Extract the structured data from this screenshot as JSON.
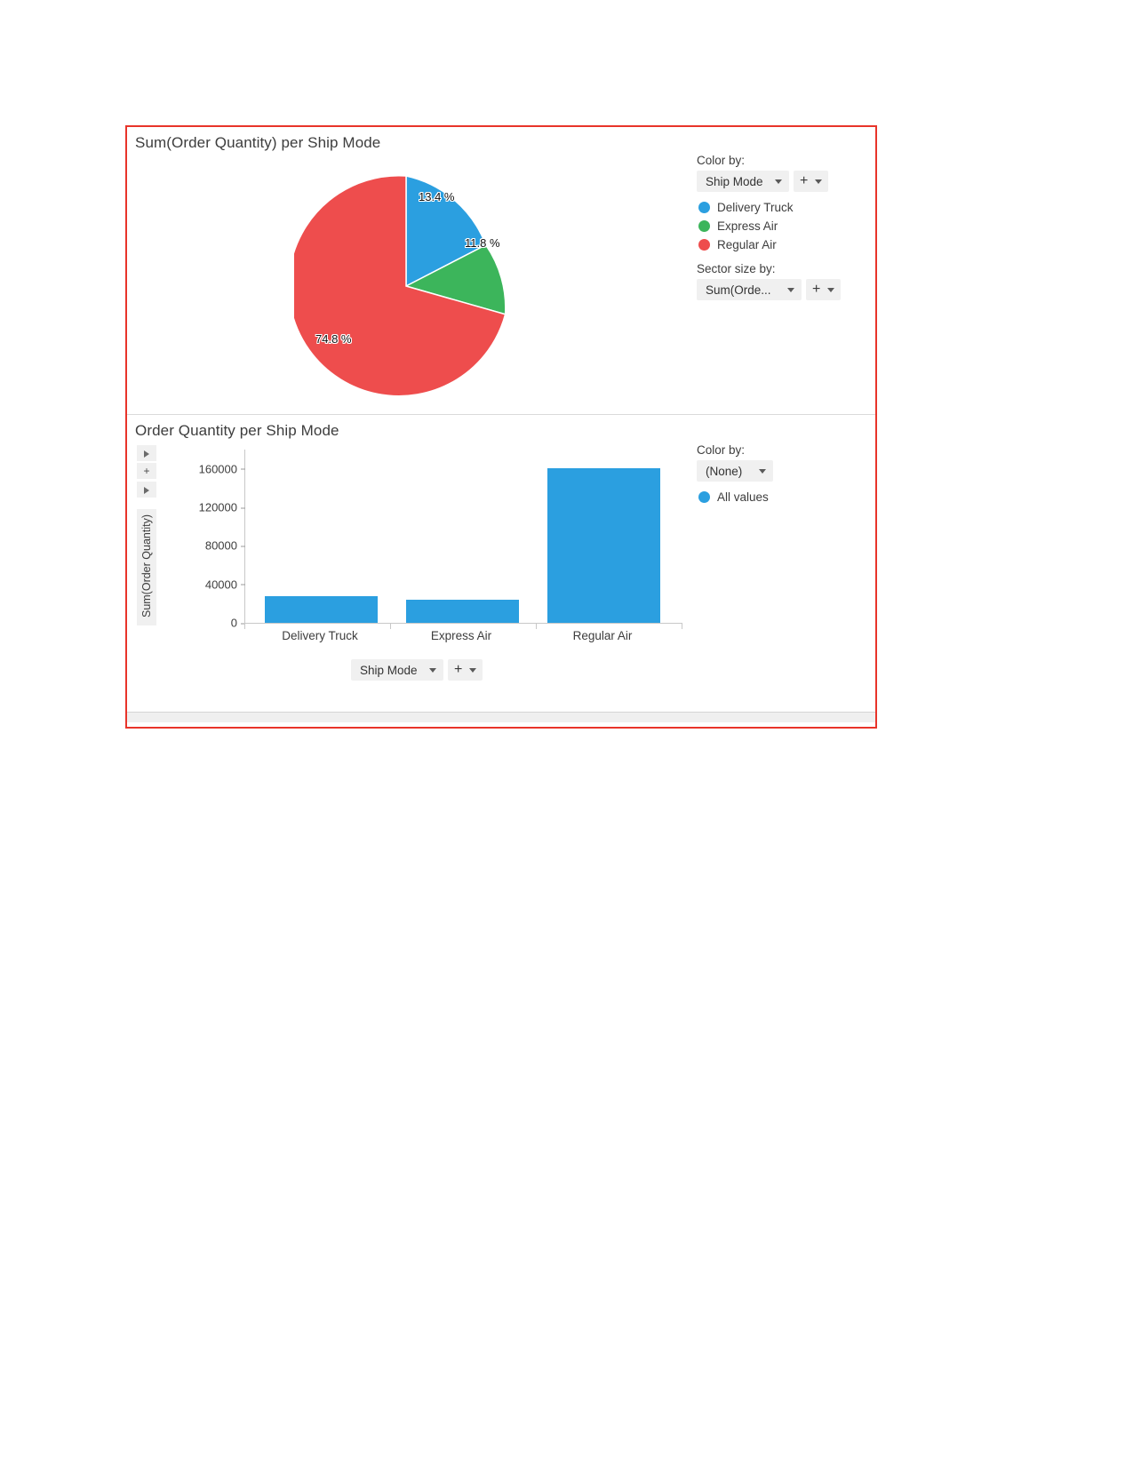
{
  "dashboard": {
    "accent_border_color": "#e8342a"
  },
  "pie_panel": {
    "title": "Sum(Order Quantity) per Ship Mode",
    "color_by_label": "Color by:",
    "color_by_value": "Ship Mode",
    "color_by_add_label": "+",
    "sector_size_label": "Sector size by:",
    "sector_size_value": "Sum(Orde...",
    "sector_size_add_label": "+",
    "legend": [
      {
        "label": "Delivery Truck",
        "color": "#2b9fe0"
      },
      {
        "label": "Express Air",
        "color": "#3cb55b"
      },
      {
        "label": "Regular Air",
        "color": "#ee4d4d"
      }
    ],
    "slice_labels": {
      "delivery_truck": "13.4 %",
      "express_air": "11.8 %",
      "regular_air": "74.8 %"
    }
  },
  "bar_panel": {
    "title": "Order Quantity per Ship Mode",
    "color_by_label": "Color by:",
    "color_by_value": "(None)",
    "legend": [
      {
        "label": "All values",
        "color": "#2b9fe0"
      }
    ],
    "y_axis_title": "Sum(Order Quantity)",
    "x_axis_value": "Ship Mode",
    "x_axis_add_label": "+",
    "expand_glyph": "+"
  },
  "chart_data": [
    {
      "type": "pie",
      "title": "Sum(Order Quantity) per Ship Mode",
      "labels": [
        "Delivery Truck",
        "Express Air",
        "Regular Air"
      ],
      "values": [
        13.4,
        11.8,
        74.8
      ],
      "value_labels": [
        "13.4 %",
        "11.8 %",
        "74.8 %"
      ],
      "colors": [
        "#2b9fe0",
        "#3cb55b",
        "#ee4d4d"
      ],
      "legend_position": "right",
      "units": "percent"
    },
    {
      "type": "bar",
      "title": "Order Quantity per Ship Mode",
      "categories": [
        "Delivery Truck",
        "Express Air",
        "Regular Air"
      ],
      "values": [
        27500,
        24500,
        161000
      ],
      "series": [
        {
          "name": "All values",
          "values": [
            27500,
            24500,
            161000
          ],
          "color": "#2b9fe0"
        }
      ],
      "xlabel": "Ship Mode",
      "ylabel": "Sum(Order Quantity)",
      "yticks": [
        0,
        40000,
        80000,
        120000,
        160000
      ],
      "ytick_labels": [
        "0",
        "40000",
        "80000",
        "120000",
        "160000"
      ],
      "ylim": [
        0,
        180000
      ],
      "grid": false,
      "legend_position": "right"
    }
  ]
}
